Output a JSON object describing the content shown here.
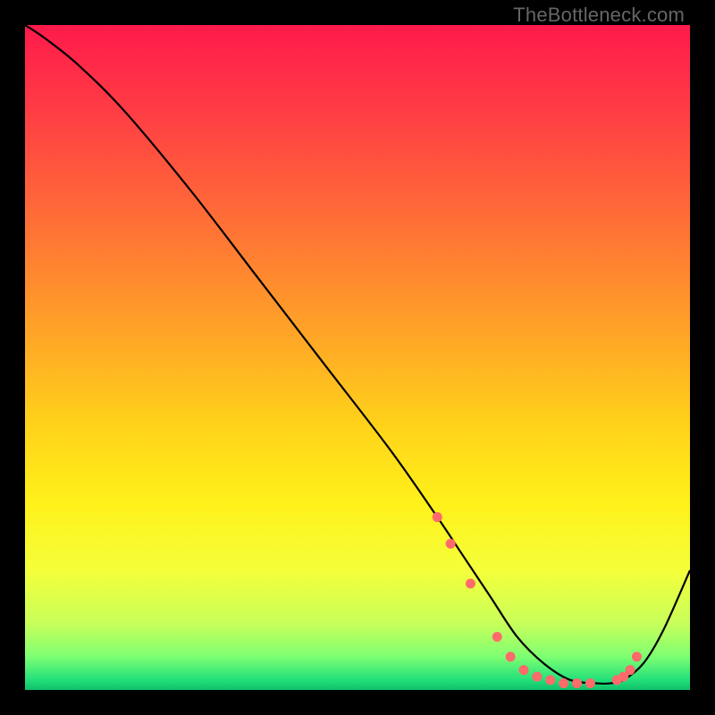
{
  "watermark": "TheBottleneck.com",
  "chart_data": {
    "type": "line",
    "title": "",
    "xlabel": "",
    "ylabel": "",
    "xlim": [
      0,
      100
    ],
    "ylim": [
      0,
      100
    ],
    "grid": false,
    "legend": false,
    "background_gradient": {
      "stops": [
        {
          "offset": 0.0,
          "color": "#ff1a4b"
        },
        {
          "offset": 0.12,
          "color": "#ff3a45"
        },
        {
          "offset": 0.28,
          "color": "#ff6a38"
        },
        {
          "offset": 0.45,
          "color": "#ffa028"
        },
        {
          "offset": 0.6,
          "color": "#ffd21a"
        },
        {
          "offset": 0.72,
          "color": "#fff11a"
        },
        {
          "offset": 0.82,
          "color": "#f4ff3a"
        },
        {
          "offset": 0.9,
          "color": "#c8ff5a"
        },
        {
          "offset": 0.95,
          "color": "#7dff72"
        },
        {
          "offset": 0.985,
          "color": "#22e07a"
        },
        {
          "offset": 1.0,
          "color": "#0fbf6a"
        }
      ]
    },
    "series": [
      {
        "name": "bottleneck-curve",
        "color": "#000000",
        "x": [
          0,
          3,
          8,
          15,
          25,
          35,
          45,
          55,
          62,
          66,
          70,
          74,
          78,
          82,
          86,
          88,
          90,
          93,
          96,
          100
        ],
        "y": [
          100,
          98,
          94,
          87,
          75,
          62,
          49,
          36,
          26,
          20,
          14,
          8,
          4,
          1.5,
          1,
          1,
          1.5,
          4,
          9,
          18
        ]
      }
    ],
    "markers": {
      "name": "highlight-points",
      "color": "#ff6a6a",
      "x": [
        62,
        64,
        67,
        71,
        73,
        75,
        77,
        79,
        81,
        83,
        85,
        89,
        90,
        91,
        92
      ],
      "y": [
        26,
        22,
        16,
        8,
        5,
        3,
        2,
        1.5,
        1,
        1,
        1,
        1.5,
        2,
        3,
        5
      ]
    }
  }
}
